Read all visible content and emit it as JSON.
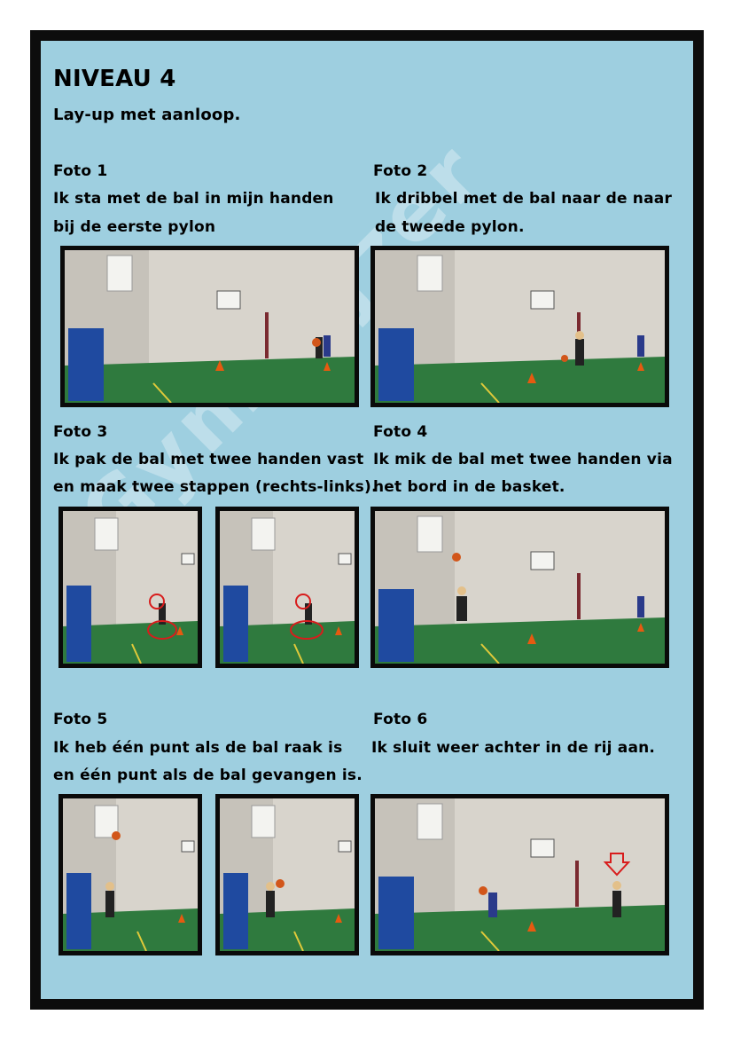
{
  "header": {
    "level": "NIVEAU 4",
    "subtitle": "Lay-up met aanloop."
  },
  "watermark": "Gymwijzer",
  "steps": [
    {
      "label": "Foto 1",
      "line1": "Ik sta met de bal in mijn handen",
      "line2": "bij de eerste pylon"
    },
    {
      "label": "Foto 2",
      "line1": "Ik dribbel met de bal naar de naar",
      "line2": "de tweede pylon."
    },
    {
      "label": "Foto 3",
      "line1": "Ik pak de bal met twee handen vast",
      "line2": "en maak twee stappen (rechts-links)."
    },
    {
      "label": "Foto 4",
      "line1": "Ik mik de bal met twee handen via",
      "line2": "het bord in de basket."
    },
    {
      "label": "Foto 5",
      "line1": "Ik heb één punt als de bal raak is",
      "line2": "en één punt als de bal gevangen is."
    },
    {
      "label": "Foto 6",
      "line1": "Ik sluit weer achter in de rij aan.",
      "line2": ""
    }
  ],
  "colors": {
    "background": "#9ecfe0",
    "border": "#0d0d0d",
    "floor": "#2f7a3e",
    "wall": "#d8d4cc",
    "mats": "#1f4aa0",
    "cone": "#e65a10",
    "annotation": "#d81c1c"
  }
}
